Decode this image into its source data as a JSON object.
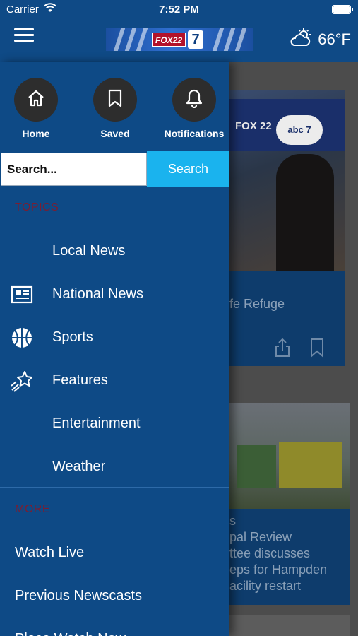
{
  "status_bar": {
    "carrier": "Carrier",
    "time": "7:52 PM"
  },
  "header": {
    "logo": {
      "fox_text": "FOX22",
      "seven_text": "7"
    },
    "weather": {
      "temperature": "66°F",
      "icon": "partly-cloudy-icon"
    }
  },
  "drawer": {
    "quick_actions": [
      {
        "label": "Home",
        "icon": "home-icon"
      },
      {
        "label": "Saved",
        "icon": "bookmark-icon"
      },
      {
        "label": "Notifications",
        "icon": "bell-icon"
      }
    ],
    "search": {
      "placeholder": "Search...",
      "button_label": "Search"
    },
    "topics_title": "TOPICS",
    "topics": [
      {
        "label": "Local News",
        "icon": ""
      },
      {
        "label": "National News",
        "icon": "newspaper-icon"
      },
      {
        "label": "Sports",
        "icon": "basketball-icon"
      },
      {
        "label": "Features",
        "icon": "shooting-star-icon"
      },
      {
        "label": "Entertainment",
        "icon": ""
      },
      {
        "label": "Weather",
        "icon": ""
      }
    ],
    "more_title": "MORE",
    "more_items": [
      {
        "label": "Watch Live"
      },
      {
        "label": "Previous Newscasts"
      },
      {
        "label": "Place Watch Now"
      }
    ]
  },
  "feed": {
    "cards": [
      {
        "headline_visible": "fe Refuge",
        "image_text": {
          "fox": "FOX 22",
          "abc": "abc 7"
        }
      },
      {
        "headline_visible": "s\npal Review\nttee discusses\neps for Hampden\nacility restart"
      }
    ]
  },
  "colors": {
    "header_bg": "#0f4a86",
    "drawer_bg": "#0e4a86",
    "search_button": "#1ab3ee",
    "section_title": "#7a1e32"
  }
}
